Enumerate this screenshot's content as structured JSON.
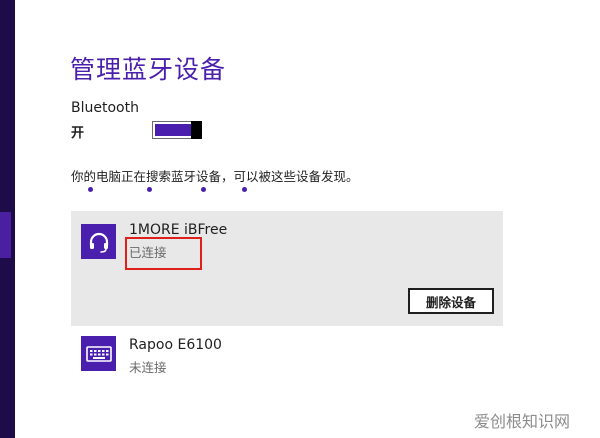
{
  "page": {
    "title": "管理蓝牙设备"
  },
  "bluetooth": {
    "label": "Bluetooth",
    "state_text": "开",
    "toggle_on": true
  },
  "search": {
    "message": "你的电脑正在搜索蓝牙设备，可以被这些设备发现。"
  },
  "devices": [
    {
      "name": "1MORE iBFree",
      "status": "已连接",
      "icon": "headset-icon",
      "selected": true,
      "action_label": "删除设备"
    },
    {
      "name": "Rapoo E6100",
      "status": "未连接",
      "icon": "keyboard-icon",
      "selected": false
    }
  ],
  "watermark": "爱创根知识网",
  "colors": {
    "accent": "#4b1fae",
    "sidebar": "#1e0b4a",
    "selected_bg": "#e8e8e8",
    "highlight": "#e0201b"
  }
}
